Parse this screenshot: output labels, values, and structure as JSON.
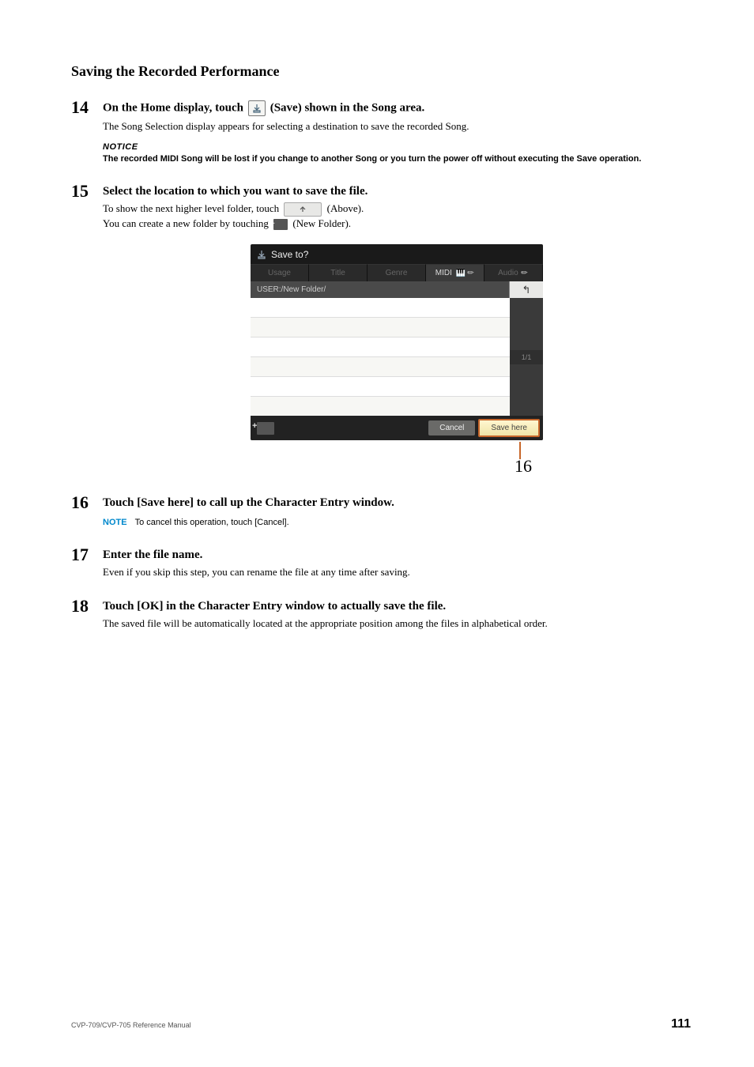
{
  "heading": "Saving the Recorded Performance",
  "steps": {
    "s14": {
      "num": "14",
      "title_before": "On the Home display, touch ",
      "title_after": " (Save) shown in the Song area.",
      "desc": "The Song Selection display appears for selecting a destination to save the recorded Song.",
      "notice_label": "NOTICE",
      "notice_text": "The recorded MIDI Song will be lost if you change to another Song or you turn the power off without executing the Save operation."
    },
    "s15": {
      "num": "15",
      "title": "Select the location to which you want to save the file.",
      "desc_l1_a": "To show the next higher level folder, touch ",
      "desc_l1_b": " (Above).",
      "desc_l2_a": "You can create a new folder by touching ",
      "desc_l2_b": " (New Folder)."
    },
    "s16": {
      "num": "16",
      "title": "Touch [Save here] to call up the Character Entry window.",
      "note_label": "NOTE",
      "note_text": "To cancel this operation, touch [Cancel]."
    },
    "s17": {
      "num": "17",
      "title": "Enter the file name.",
      "desc": "Even if you skip this step, you can rename the file at any time after saving."
    },
    "s18": {
      "num": "18",
      "title": "Touch [OK] in the Character Entry window to actually save the file.",
      "desc": "The saved file will be automatically located at the appropriate position among the files in alphabetical order."
    }
  },
  "screenshot": {
    "title": "Save to?",
    "tabs": {
      "usage": "Usage",
      "title": "Title",
      "genre": "Genre",
      "midi": "MIDI",
      "audio": "Audio"
    },
    "path": "USER:/New Folder/",
    "up_glyph": "↰",
    "page_indicator": "1/1",
    "cancel": "Cancel",
    "save_here": "Save here",
    "callout_num": "16"
  },
  "footer": {
    "left": "CVP-709/CVP-705 Reference Manual",
    "page": "111"
  }
}
